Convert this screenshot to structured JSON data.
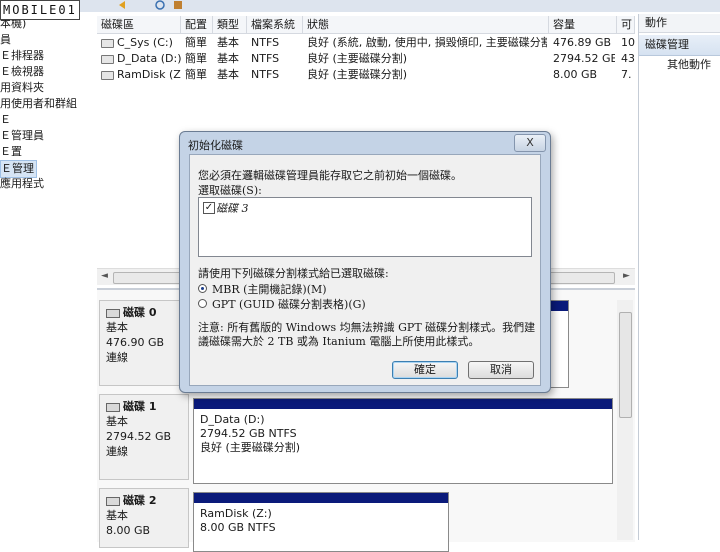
{
  "watermark": "MOBILE01",
  "tree": {
    "items": [
      "本機)",
      "員",
      "Ｅ排程器",
      "Ｅ檢視器",
      "用資料夾",
      "用使用者和群組",
      "Ｅ",
      "Ｅ管理員",
      "Ｅ置",
      "Ｅ管理",
      "應用程式"
    ],
    "selected_index": 9
  },
  "volumes": {
    "columns": [
      "磁碟區",
      "配置",
      "類型",
      "檔案系統",
      "狀態",
      "容量",
      "可"
    ],
    "rows": [
      {
        "name": "C_Sys (C:)",
        "layout": "簡單",
        "type": "基本",
        "fs": "NTFS",
        "status": "良好 (系統, 啟動, 使用中, 損毀傾印, 主要磁碟分割)",
        "capacity": "476.89 GB",
        "free": "10"
      },
      {
        "name": "D_Data (D:)",
        "layout": "簡單",
        "type": "基本",
        "fs": "NTFS",
        "status": "良好 (主要磁碟分割)",
        "capacity": "2794.52 GB",
        "free": "43"
      },
      {
        "name": "RamDisk (Z:)",
        "layout": "簡單",
        "type": "基本",
        "fs": "NTFS",
        "status": "良好 (主要磁碟分割)",
        "capacity": "8.00 GB",
        "free": "7."
      }
    ]
  },
  "disks": [
    {
      "name": "磁碟 0",
      "type": "基本",
      "size": "476.90 GB",
      "state": "連線"
    },
    {
      "name": "磁碟 1",
      "type": "基本",
      "size": "2794.52 GB",
      "state": "連線",
      "partition": {
        "label": "D_Data  (D:)",
        "size": "2794.52 GB NTFS",
        "status": "良好 (主要磁碟分割)"
      }
    },
    {
      "name": "磁碟 2",
      "type": "基本",
      "size": "8.00 GB",
      "state": "",
      "partition": {
        "label": "RamDisk  (Z:)",
        "size": "8.00 GB NTFS",
        "status": ""
      }
    }
  ],
  "actions": {
    "title": "動作",
    "section": "磁碟管理",
    "item": "其他動作"
  },
  "dialog": {
    "title": "初始化磁碟",
    "close": "X",
    "intro": "您必須在邏輯磁碟管理員能存取它之前初始一個磁碟。",
    "select_label": "選取磁碟(S):",
    "disk_item": "磁碟 3",
    "partition_label": "請使用下列磁碟分割樣式給已選取磁碟:",
    "mbr": "MBR (主開機記錄)(M)",
    "gpt": "GPT (GUID 磁碟分割表格)(G)",
    "note": "注意: 所有舊版的 Windows 均無法辨識 GPT 磁碟分割樣式。我們建議磁碟需大於 2 TB 或為 Itanium 電腦上所使用此樣式。",
    "ok": "確定",
    "cancel": "取消"
  }
}
